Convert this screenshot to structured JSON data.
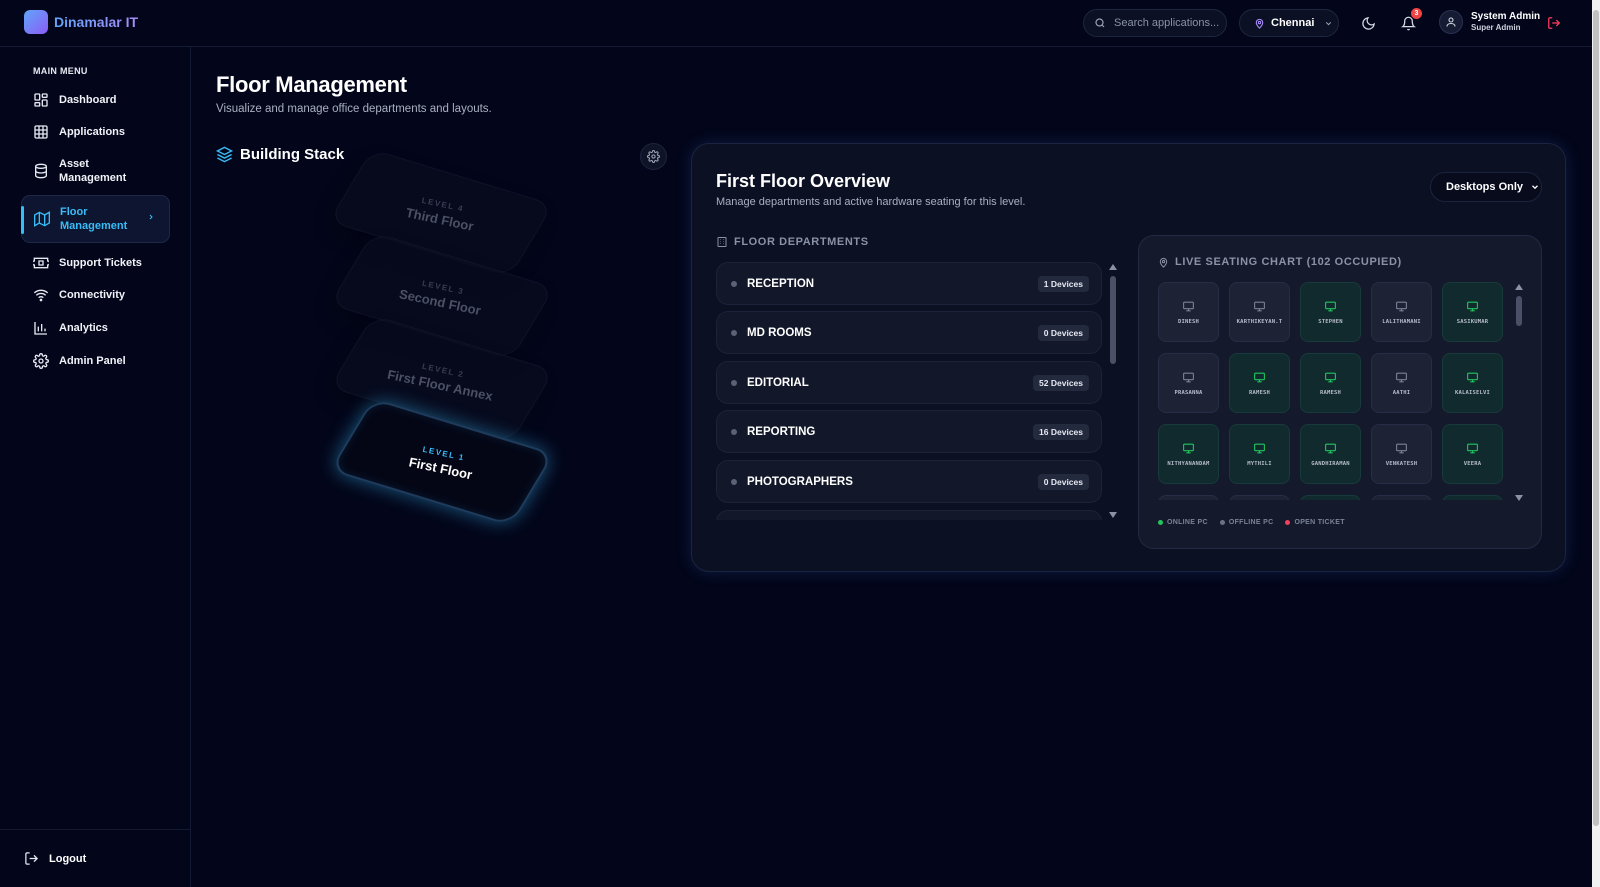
{
  "app": {
    "name": "Dinamalar IT"
  },
  "header": {
    "search_placeholder": "Search applications...",
    "location": "Chennai",
    "notifications_count": "3",
    "user_name": "System Admin",
    "user_role": "Super Admin"
  },
  "sidebar": {
    "menu_title": "MAIN MENU",
    "items": [
      {
        "label": "Dashboard",
        "icon": "dashboard-icon"
      },
      {
        "label": "Applications",
        "icon": "grid-icon"
      },
      {
        "label": "Asset Management",
        "icon": "database-icon"
      },
      {
        "label": "Floor Management",
        "icon": "map-icon"
      },
      {
        "label": "Support Tickets",
        "icon": "ticket-icon"
      },
      {
        "label": "Connectivity",
        "icon": "wifi-icon"
      },
      {
        "label": "Analytics",
        "icon": "bar-chart-icon"
      },
      {
        "label": "Admin Panel",
        "icon": "gear-icon"
      }
    ],
    "logout_label": "Logout"
  },
  "main": {
    "title": "Floor Management",
    "subtitle": "Visualize and manage office departments and layouts.",
    "building_stack_title": "Building Stack",
    "floors": [
      {
        "level": "LEVEL 4",
        "name": "Third Floor",
        "active": false
      },
      {
        "level": "LEVEL 3",
        "name": "Second Floor",
        "active": false
      },
      {
        "level": "LEVEL 2",
        "name": "First Floor Annex",
        "active": false
      },
      {
        "level": "LEVEL 1",
        "name": "First Floor",
        "active": true
      }
    ]
  },
  "overview": {
    "title": "First Floor Overview",
    "subtitle": "Manage departments and active hardware seating for this level.",
    "filter_label": "Desktops Only",
    "departments_title": "FLOOR DEPARTMENTS",
    "departments": [
      {
        "name": "RECEPTION",
        "devices": "1 Devices"
      },
      {
        "name": "MD ROOMS",
        "devices": "0 Devices"
      },
      {
        "name": "EDITORIAL",
        "devices": "52 Devices"
      },
      {
        "name": "REPORTING",
        "devices": "16 Devices"
      },
      {
        "name": "PHOTOGRAPHERS",
        "devices": "0 Devices"
      }
    ],
    "seating_title": "LIVE SEATING CHART (102 OCCUPIED)",
    "seats": [
      {
        "name": "DINESH",
        "status": "offline"
      },
      {
        "name": "KARTHIKEYAN.T",
        "status": "offline"
      },
      {
        "name": "STEPHEN",
        "status": "online"
      },
      {
        "name": "LALITHAMANI",
        "status": "offline"
      },
      {
        "name": "SASIKUMAR",
        "status": "online"
      },
      {
        "name": "PRASANNA",
        "status": "offline"
      },
      {
        "name": "RAMESH",
        "status": "online"
      },
      {
        "name": "RAMESH",
        "status": "online"
      },
      {
        "name": "AATHI",
        "status": "offline"
      },
      {
        "name": "KALAISELVI",
        "status": "online"
      },
      {
        "name": "NITHYANANDAM",
        "status": "online"
      },
      {
        "name": "MYTHILI",
        "status": "online"
      },
      {
        "name": "GANDHIRAMAN",
        "status": "online"
      },
      {
        "name": "VENKATESH",
        "status": "offline"
      },
      {
        "name": "VEERA",
        "status": "online"
      }
    ],
    "legend": [
      {
        "label": "ONLINE PC",
        "color": "#22c55e"
      },
      {
        "label": "OFFLINE PC",
        "color": "#6b7280"
      },
      {
        "label": "OPEN TICKET",
        "color": "#f43f5e"
      }
    ]
  },
  "colors": {
    "accent": "#38bdf8",
    "online": "#22c55e",
    "background": "#03061a"
  }
}
